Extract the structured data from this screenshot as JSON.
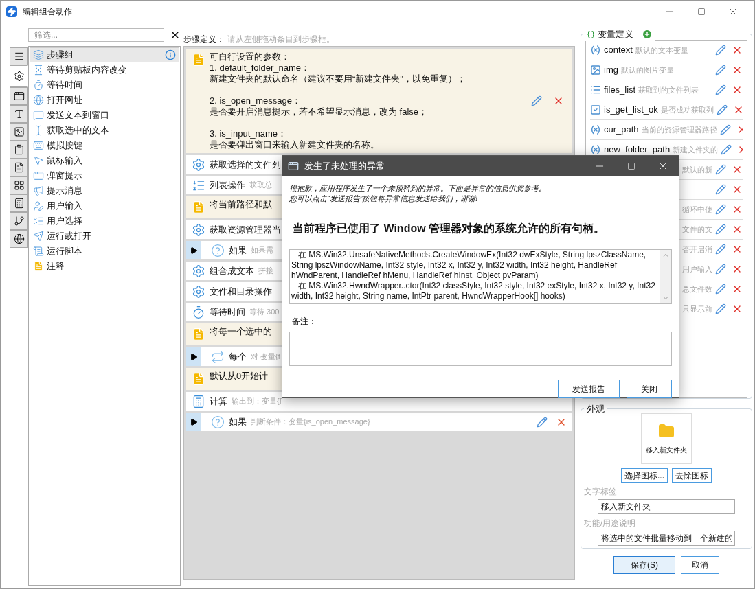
{
  "window": {
    "title": "编辑组合动作"
  },
  "toolbox": {
    "filter_placeholder": "筛选...",
    "tabs": [
      {
        "selected": false
      },
      {
        "selected": true
      },
      {
        "selected": false
      },
      {
        "selected": false
      },
      {
        "selected": false
      },
      {
        "selected": false
      },
      {
        "selected": false
      },
      {
        "selected": false
      },
      {
        "selected": false
      },
      {
        "selected": false
      },
      {
        "selected": false
      }
    ],
    "items": [
      {
        "label": "步骤组",
        "selected": true
      },
      {
        "label": "等待剪贴板内容改变",
        "selected": false
      },
      {
        "label": "等待时间",
        "selected": false
      },
      {
        "label": "打开网址",
        "selected": false
      },
      {
        "label": "发送文本到窗口",
        "selected": false
      },
      {
        "label": "获取选中的文本",
        "selected": false
      },
      {
        "label": "模拟按键",
        "selected": false
      },
      {
        "label": "鼠标输入",
        "selected": false
      },
      {
        "label": "弹窗提示",
        "selected": false
      },
      {
        "label": "提示消息",
        "selected": false
      },
      {
        "label": "用户输入",
        "selected": false
      },
      {
        "label": "用户选择",
        "selected": false
      },
      {
        "label": "运行或打开",
        "selected": false
      },
      {
        "label": "运行脚本",
        "selected": false
      },
      {
        "label": "注释",
        "selected": false
      }
    ]
  },
  "steps": {
    "label": "步骤定义：",
    "hint": "请从左侧拖动条目到步骤框。",
    "items": [
      {
        "kind": "note",
        "paragraphs": [
          [
            "可自行设置的参数：",
            "1. default_folder_name：",
            "新建文件夹的默认命名（建议不要用“新建文件夹”，以免重复）；"
          ],
          [
            "2. is_open_message：",
            "是否要开启消息提示，若不希望显示消息，改为 false；"
          ],
          [
            "3. is_input_name：",
            "是否要弹出窗口来输入新建文件夹的名称。"
          ]
        ]
      },
      {
        "kind": "action",
        "title": "获取选择的文件列"
      },
      {
        "kind": "list",
        "title": "列表操作",
        "desc": "获取总"
      },
      {
        "kind": "note",
        "paragraphs": [
          [
            "将当前路径和默"
          ]
        ]
      },
      {
        "kind": "action",
        "title": "获取资源管理器当"
      },
      {
        "kind": "branch",
        "title": "如果",
        "desc": "如果需"
      },
      {
        "kind": "action",
        "title": "组合成文本",
        "desc": "拼接"
      },
      {
        "kind": "action",
        "title": "文件和目录操作"
      },
      {
        "kind": "timer",
        "title": "等待时间",
        "desc": "等待 300"
      },
      {
        "kind": "note",
        "paragraphs": [
          [
            "将每一个选中的"
          ]
        ]
      },
      {
        "kind": "loop",
        "title": "每个",
        "desc": "对 变量{f"
      },
      {
        "kind": "note",
        "paragraphs": [
          [
            "默认从0开始计"
          ]
        ]
      },
      {
        "kind": "calc",
        "title": "计算",
        "desc": "输出到：变量{f"
      },
      {
        "kind": "branch",
        "title": "如果",
        "desc": "判断条件：变量{is_open_message}"
      }
    ]
  },
  "variables": {
    "title": "变量定义",
    "items": [
      {
        "kind": "text",
        "name": "context",
        "desc": "默认的文本变量"
      },
      {
        "kind": "image",
        "name": "img",
        "desc": "默认的图片变量"
      },
      {
        "kind": "list",
        "name": "files_list",
        "desc": "获取到的文件列表"
      },
      {
        "kind": "bool",
        "name": "is_get_list_ok",
        "desc": "是否成功获取列"
      },
      {
        "kind": "text",
        "name": "cur_path",
        "desc": "当前的资源管理器路径"
      },
      {
        "kind": "text",
        "name": "new_folder_path",
        "desc": "新建文件夹的"
      },
      {
        "kind": "hidden",
        "desc": "默认的新"
      },
      {
        "kind": "hidden"
      },
      {
        "kind": "hidden",
        "desc": "循环中使"
      },
      {
        "kind": "hidden",
        "desc": "文件的文"
      },
      {
        "kind": "hidden",
        "desc": "否开启消"
      },
      {
        "kind": "hidden",
        "desc": "用户输入"
      },
      {
        "kind": "hidden",
        "desc": "总文件数"
      },
      {
        "kind": "hidden",
        "desc": "只显示前"
      }
    ]
  },
  "appearance": {
    "title": "外观",
    "icon_caption": "移入新文件夹",
    "choose_icon": "选择图标...",
    "remove_icon": "去除图标",
    "label_caption": "文字标签",
    "label_value": "移入新文件夹",
    "desc_caption": "功能/用途说明",
    "desc_value": "将选中的文件批量移动到一个新建的"
  },
  "buttons": {
    "save": "保存(S)",
    "cancel": "取消"
  },
  "dialog": {
    "title": "发生了未处理的异常",
    "intro": [
      "很抱歉，应用程序发生了一个未预料到的异常。下面是异常的信息供您参考。",
      "您可以点击“发送报告”按钮将异常信息发送给我们，谢谢!"
    ],
    "heading": "当前程序已使用了 Window 管理器对象的系统允许的所有句柄。",
    "trace": [
      "   在 MS.Win32.UnsafeNativeMethods.CreateWindowEx(Int32 dwExStyle, String lpszClassName, String lpszWindowName, Int32 style, Int32 x, Int32 y, Int32 width, Int32 height, HandleRef hWndParent, HandleRef hMenu, HandleRef hInst, Object pvParam)",
      "   在 MS.Win32.HwndWrapper..ctor(Int32 classStyle, Int32 style, Int32 exStyle, Int32 x, Int32 y, Int32 width, Int32 height, String name, IntPtr parent, HwndWrapperHook[] hooks)"
    ],
    "note_label": "备注：",
    "send": "发送报告",
    "close": "关闭"
  }
}
